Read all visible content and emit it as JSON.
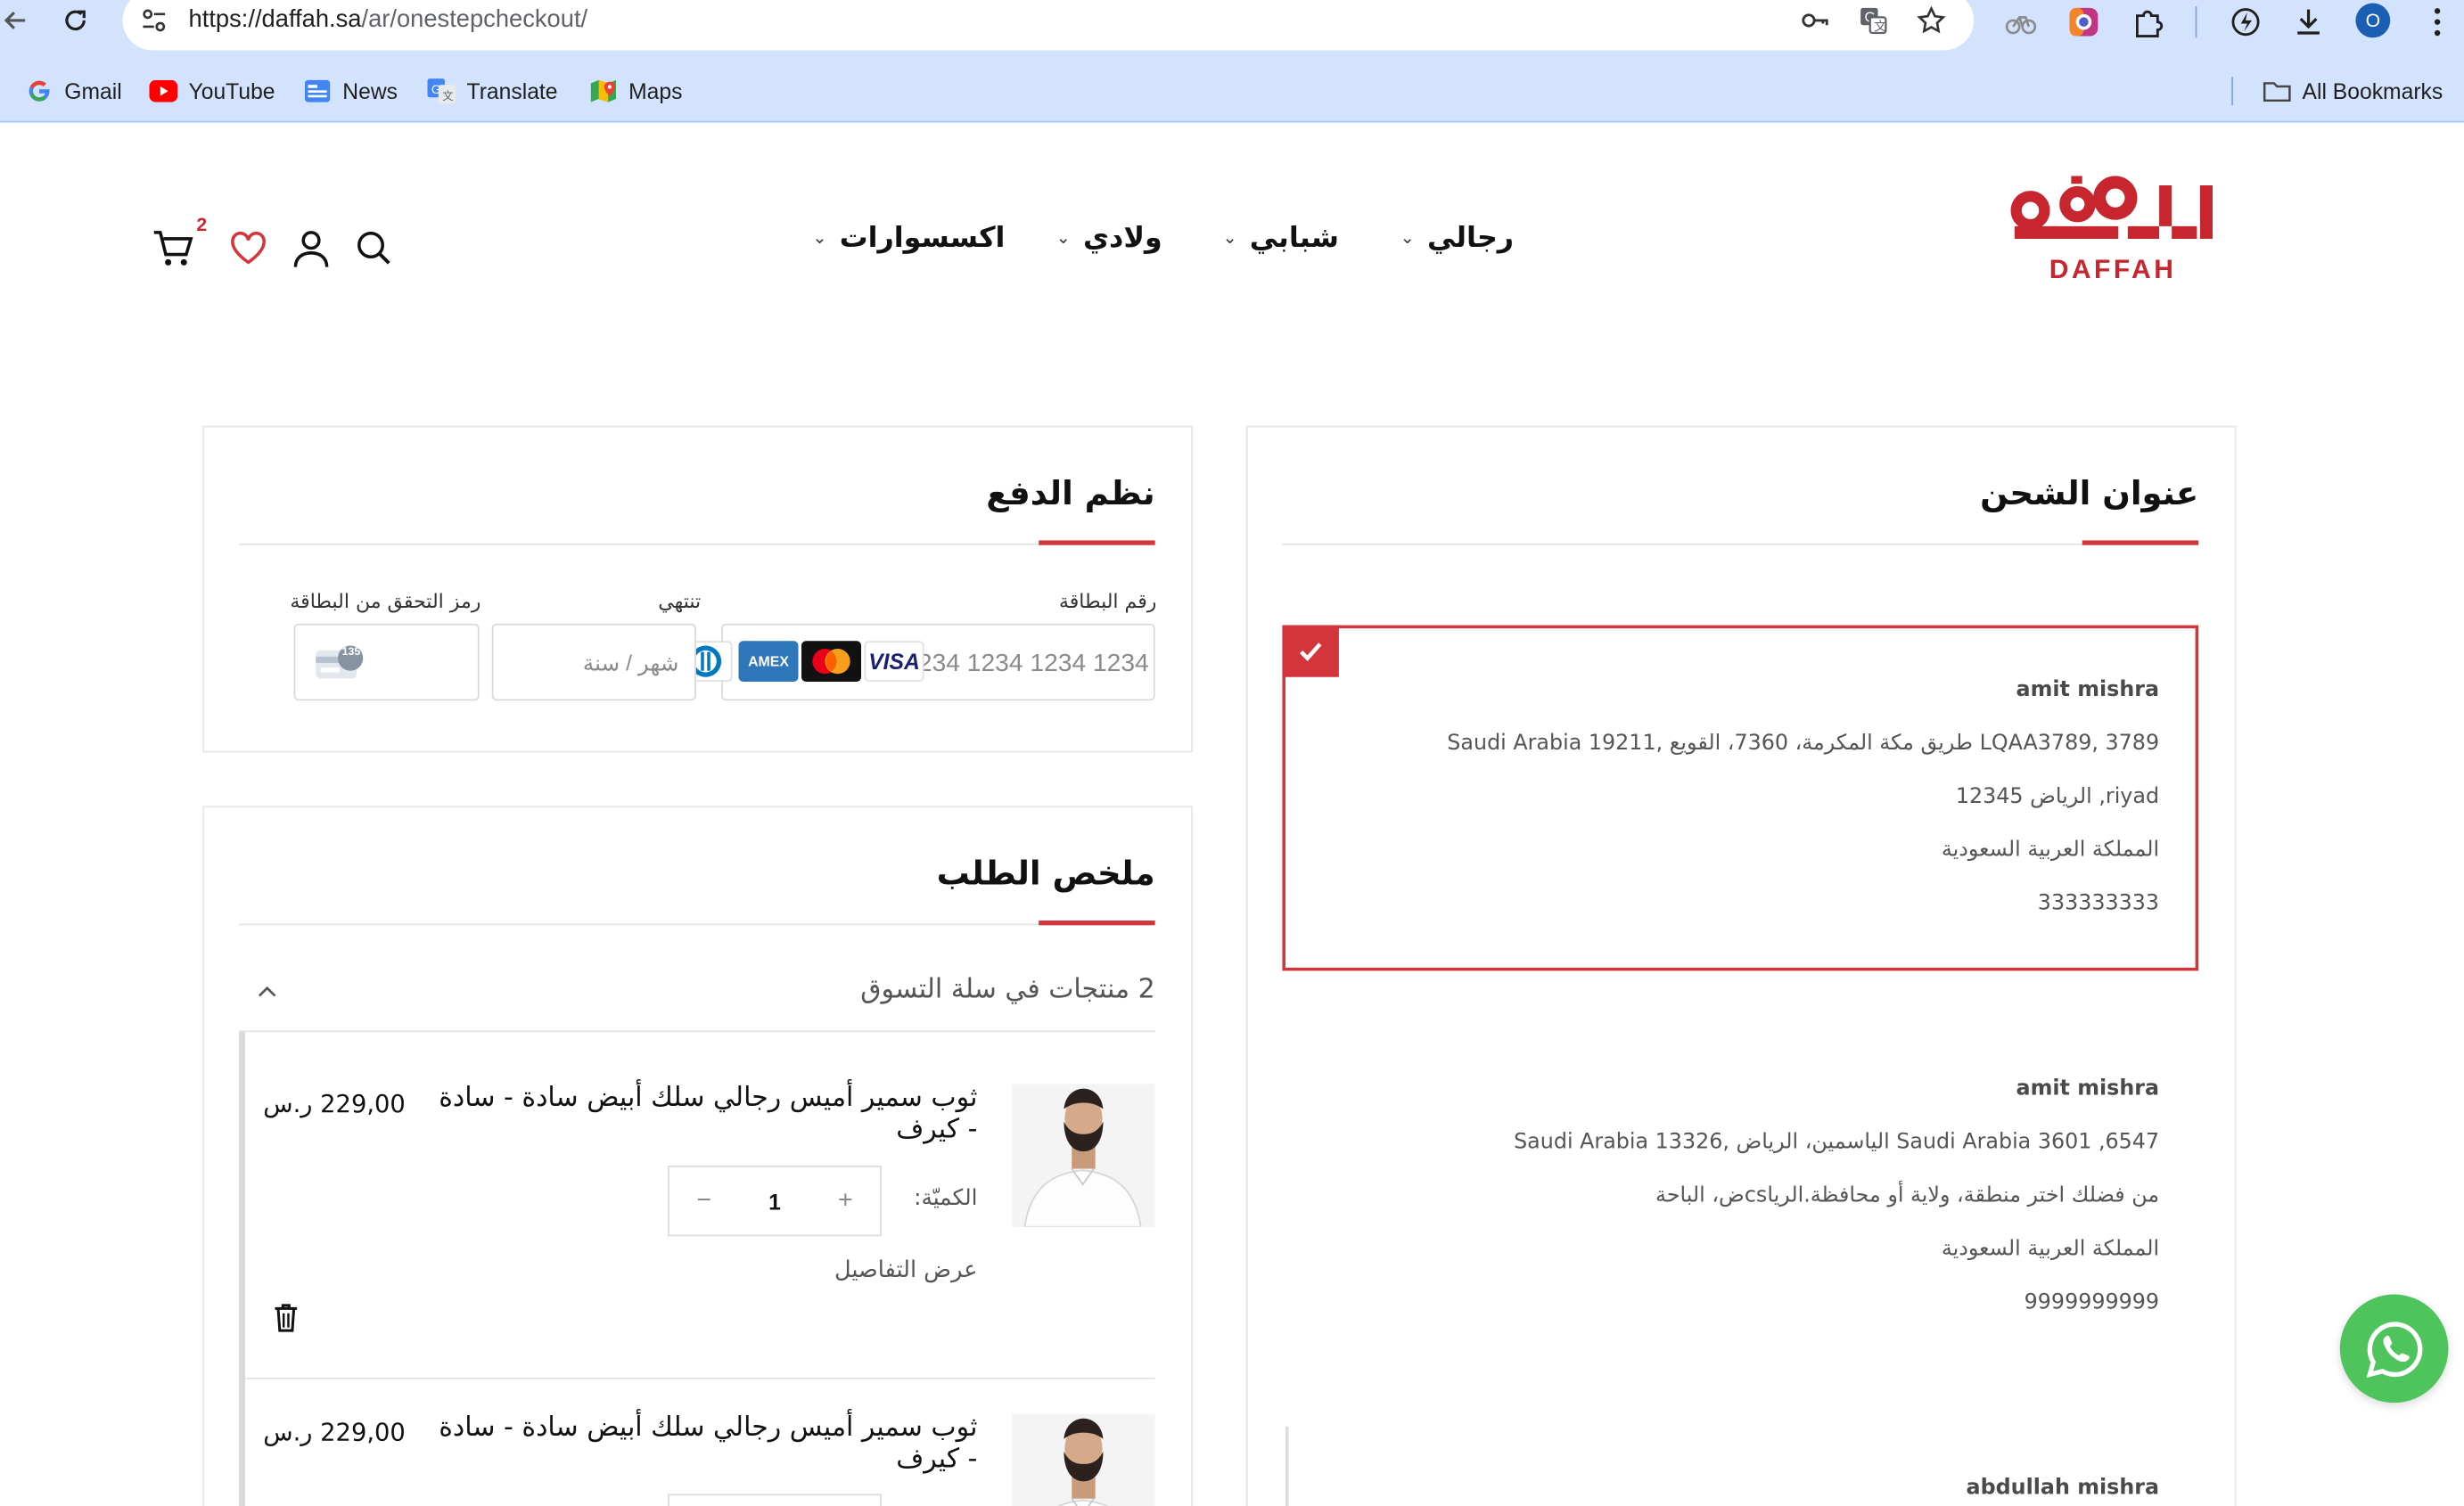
{
  "browser": {
    "url_host": "https://daffah.sa",
    "url_path": "/ar/onestepcheckout/",
    "profile_initial": "O",
    "bookmarks": [
      {
        "label": "Gmail",
        "icon": "gmail-g-icon"
      },
      {
        "label": "YouTube",
        "icon": "youtube-icon"
      },
      {
        "label": "News",
        "icon": "google-news-icon"
      },
      {
        "label": "Translate",
        "icon": "google-translate-icon"
      },
      {
        "label": "Maps",
        "icon": "google-maps-icon"
      }
    ],
    "all_bookmarks": "All Bookmarks"
  },
  "site": {
    "logo_ar": "الدفه",
    "logo_en": "DAFFAH",
    "brand_color": "#c8262f",
    "menu": [
      "رجالي",
      "شبابي",
      "ولادي",
      "اكسسوارات"
    ],
    "cart_count": "2"
  },
  "shipping": {
    "title": "عنوان الشحن",
    "addresses": [
      {
        "selected": true,
        "name": "amit mishra",
        "line1": "3789 ,LQAA3789 طريق مكة المكرمة، 7360، القويع ,19211 Saudi Arabia",
        "line2": "riyad, الرياض 12345",
        "line3": "المملكة العربية السعودية",
        "phone": "333333333"
      },
      {
        "selected": false,
        "name": "amit mishra",
        "line1": "Saudi Arabia 3601 ,6547 الياسمين، الرياض ,13326 Saudi Arabia",
        "line2": "من فضلك اختر منطقة، ولاية أو محافظة.الرياcsض، الباحة",
        "line3": "المملكة العربية السعودية",
        "phone": "9999999999"
      },
      {
        "selected": false,
        "name": "abdullah mishra"
      }
    ]
  },
  "payment": {
    "title": "نظم الدفع",
    "card_number_label": "رقم البطاقة",
    "card_number_placeholder": "1234 1234 1234 1234",
    "expiry_label": "تنتهي",
    "expiry_placeholder": "شهر / سنة",
    "cvc_label": "رمز التحقق من البطاقة",
    "cvc_icon_text": "135",
    "brands": [
      "VISA",
      "Mastercard",
      "AMEX",
      "Diners"
    ]
  },
  "summary": {
    "title": "ملخص الطلب",
    "items_count_text": "2 منتجات في سلة التسوق",
    "qty_label": "الكميّة:",
    "details_label": "عرض التفاصيل",
    "items": [
      {
        "name": "ثوب سمير أميس رجالي سلك أبيض سادة - سادة - كيرف",
        "price": "229,00 ر.س",
        "qty": "1"
      },
      {
        "name": "ثوب سمير أميس رجالي سلك أبيض سادة - سادة - كيرف",
        "price": "229,00 ر.س",
        "qty": "1"
      }
    ]
  },
  "colors": {
    "accent": "#d3353a",
    "whatsapp": "#4fc35c",
    "chrome_bar": "#d3e3fd"
  }
}
